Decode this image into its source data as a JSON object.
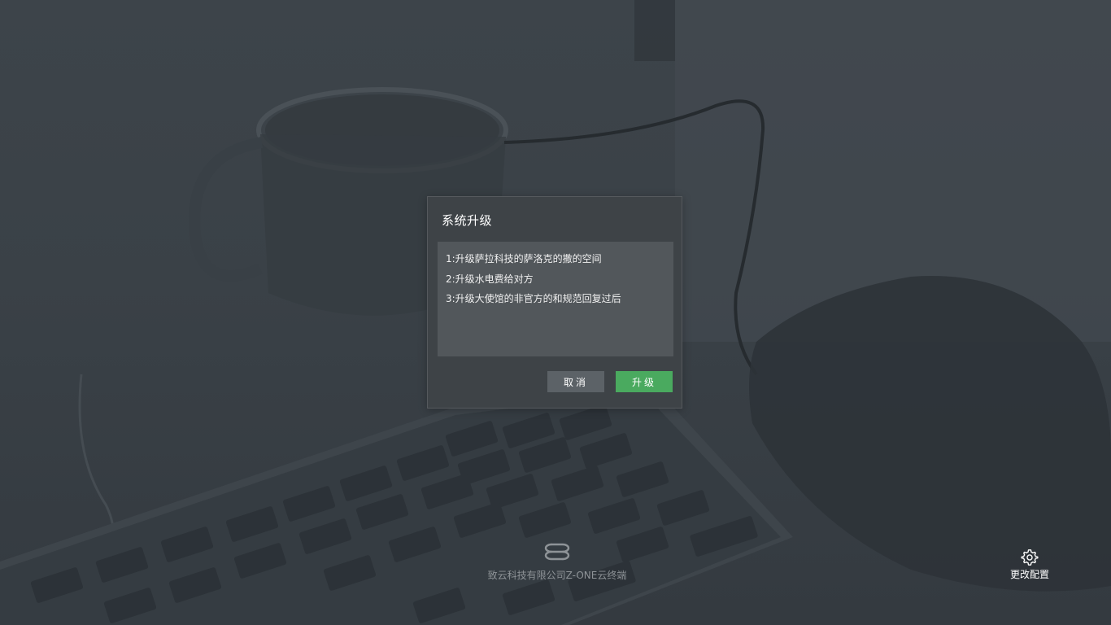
{
  "dialog": {
    "title": "系统升级",
    "notes": [
      "1:升级萨拉科技的萨洛克的撒的空间",
      "2:升级水电费给对方",
      "3:升级大使馆的非官方的和规范回复过后"
    ],
    "cancel_label": "取消",
    "upgrade_label": "升级"
  },
  "footer": {
    "brand_name": "致云科技有限公司Z-ONE云终端",
    "logo_icon": "z-one-logo-icon"
  },
  "settings": {
    "label": "更改配置",
    "icon": "gear-icon"
  },
  "colors": {
    "primary_button": "#4aaa5f",
    "secondary_button": "#5c6267",
    "dialog_background": "#3e4347"
  }
}
